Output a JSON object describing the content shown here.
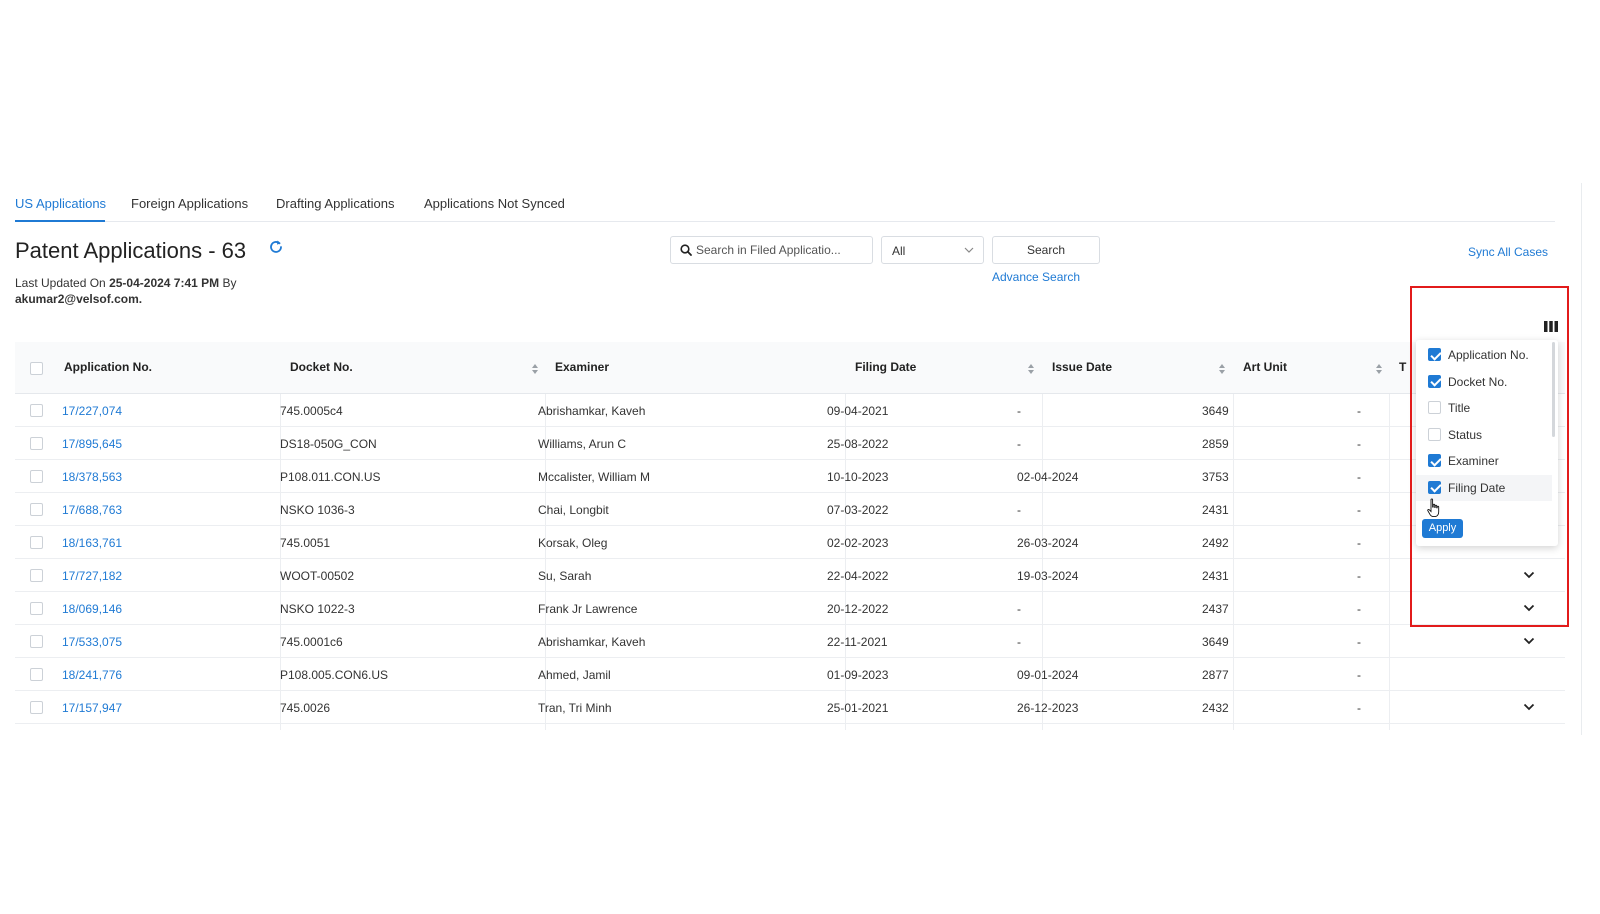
{
  "tabs": [
    {
      "label": "US Applications",
      "active": true
    },
    {
      "label": "Foreign Applications",
      "active": false
    },
    {
      "label": "Drafting Applications",
      "active": false
    },
    {
      "label": "Applications Not Synced",
      "active": false
    }
  ],
  "header": {
    "title": "Patent Applications - 63",
    "updated_prefix": "Last Updated On",
    "updated_date": "25-04-2024 7:41 PM",
    "updated_by": "By",
    "updated_email": "akumar2@velsof.com."
  },
  "search": {
    "placeholder": "Search in Filed Applicatio...",
    "filter_value": "All",
    "button_label": "Search",
    "advance_label": "Advance Search"
  },
  "sync_label": "Sync All Cases",
  "table": {
    "columns": [
      "Application No.",
      "Docket No.",
      "Examiner",
      "Filing Date",
      "Issue Date",
      "Art Unit",
      "T"
    ],
    "rows": [
      {
        "app": "17/227,074",
        "docket": "745.0005c4",
        "examiner": "Abrishamkar, Kaveh",
        "filing": "09-04-2021",
        "issue": "-",
        "art": "3649",
        "t": "-",
        "expand": false
      },
      {
        "app": "17/895,645",
        "docket": "DS18-050G_CON",
        "examiner": "Williams, Arun C",
        "filing": "25-08-2022",
        "issue": "-",
        "art": "2859",
        "t": "-",
        "expand": false
      },
      {
        "app": "18/378,563",
        "docket": "P108.011.CON.US",
        "examiner": "Mccalister, William M",
        "filing": "10-10-2023",
        "issue": "02-04-2024",
        "art": "3753",
        "t": "-",
        "expand": false
      },
      {
        "app": "17/688,763",
        "docket": "NSKO 1036-3",
        "examiner": "Chai, Longbit",
        "filing": "07-03-2022",
        "issue": "-",
        "art": "2431",
        "t": "-",
        "expand": false
      },
      {
        "app": "18/163,761",
        "docket": "745.0051",
        "examiner": "Korsak, Oleg",
        "filing": "02-02-2023",
        "issue": "26-03-2024",
        "art": "2492",
        "t": "-",
        "expand": false
      },
      {
        "app": "17/727,182",
        "docket": "WOOT-00502",
        "examiner": "Su, Sarah",
        "filing": "22-04-2022",
        "issue": "19-03-2024",
        "art": "2431",
        "t": "-",
        "expand": true
      },
      {
        "app": "18/069,146",
        "docket": "NSKO 1022-3",
        "examiner": "Frank Jr Lawrence",
        "filing": "20-12-2022",
        "issue": "-",
        "art": "2437",
        "t": "-",
        "expand": true
      },
      {
        "app": "17/533,075",
        "docket": "745.0001c6",
        "examiner": "Abrishamkar, Kaveh",
        "filing": "22-11-2021",
        "issue": "-",
        "art": "3649",
        "t": "-",
        "expand": true
      },
      {
        "app": "18/241,776",
        "docket": "P108.005.CON6.US",
        "examiner": "Ahmed, Jamil",
        "filing": "01-09-2023",
        "issue": "09-01-2024",
        "art": "2877",
        "t": "-",
        "expand": false
      },
      {
        "app": "17/157,947",
        "docket": "745.0026",
        "examiner": "Tran, Tri Minh",
        "filing": "25-01-2021",
        "issue": "26-12-2023",
        "art": "2432",
        "t": "-",
        "expand": true
      }
    ]
  },
  "column_chooser": {
    "options": [
      {
        "label": "Application No.",
        "checked": true
      },
      {
        "label": "Docket No.",
        "checked": true
      },
      {
        "label": "Title",
        "checked": false
      },
      {
        "label": "Status",
        "checked": false
      },
      {
        "label": "Examiner",
        "checked": true
      },
      {
        "label": "Filing Date",
        "checked": true
      }
    ],
    "apply_label": "Apply"
  },
  "colors": {
    "accent": "#1f7ad4",
    "highlight": "#e21b1b"
  },
  "icons": [
    "refresh-icon",
    "search-icon",
    "chevron-down-icon",
    "sort-icon",
    "columns-icon",
    "pointer-cursor-icon"
  ]
}
